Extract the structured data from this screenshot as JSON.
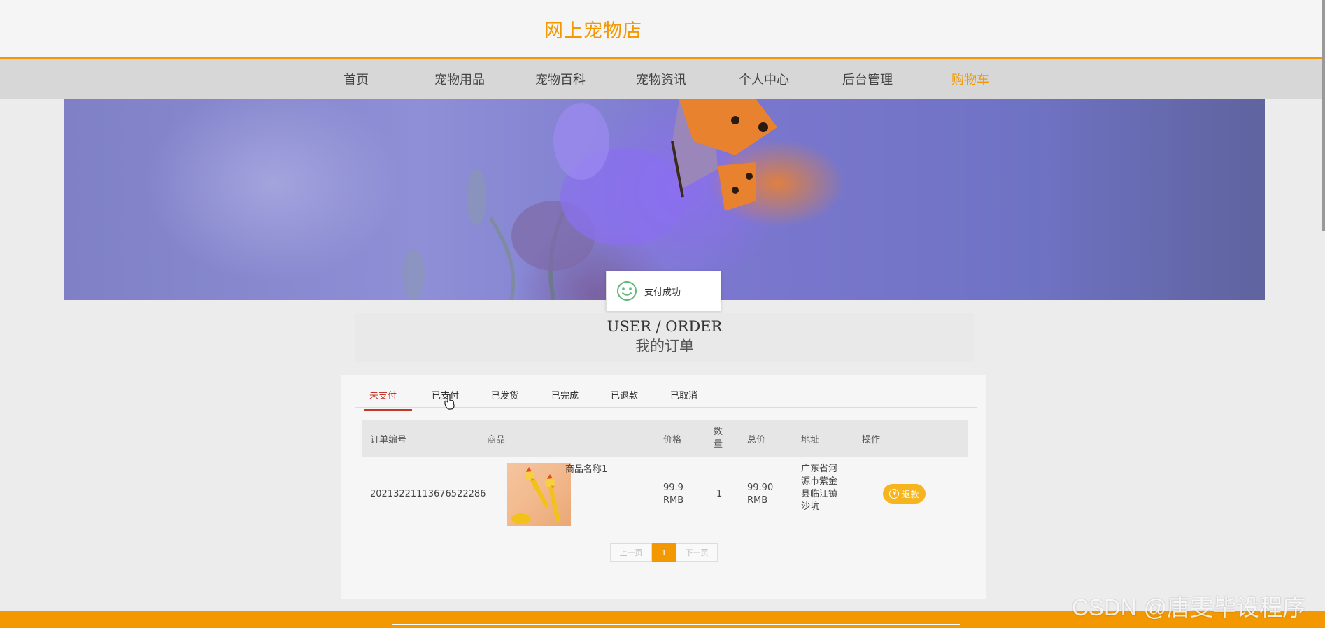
{
  "header": {
    "site_title": "网上宠物店"
  },
  "nav": {
    "items": [
      {
        "label": "首页"
      },
      {
        "label": "宠物用品"
      },
      {
        "label": "宠物百科"
      },
      {
        "label": "宠物资讯"
      },
      {
        "label": "个人中心"
      },
      {
        "label": "后台管理"
      },
      {
        "label": "购物车"
      }
    ],
    "active_label": "购物车"
  },
  "toast": {
    "message": "支付成功",
    "icon": "smile-icon"
  },
  "order_header": {
    "title_en": "USER / ORDER",
    "title_cn": "我的订单"
  },
  "tabs": [
    {
      "label": "未支付"
    },
    {
      "label": "已支付"
    },
    {
      "label": "已发货"
    },
    {
      "label": "已完成"
    },
    {
      "label": "已退款"
    },
    {
      "label": "已取消"
    }
  ],
  "active_tab": "未支付",
  "table": {
    "columns": [
      "订单编号",
      "商品",
      "价格",
      "数量",
      "总价",
      "地址",
      "操作"
    ],
    "rows": [
      {
        "order_no": "20213221113676522286",
        "product_name": "商品名称1",
        "price_value": "99.9",
        "price_unit": "RMB",
        "quantity": "1",
        "total_value": "99.90",
        "total_unit": "RMB",
        "address": "广东省河源市紫金县临江镇沙坑",
        "action_label": "退款",
        "action_icon": "yen-icon"
      }
    ]
  },
  "pagination": {
    "prev": "上一页",
    "current": "1",
    "next": "下一页"
  },
  "watermark": "CSDN @唐雯毕设程序",
  "colors": {
    "accent": "#f39800",
    "active_tab": "#c0392b",
    "refund_button": "#f6b51e"
  }
}
